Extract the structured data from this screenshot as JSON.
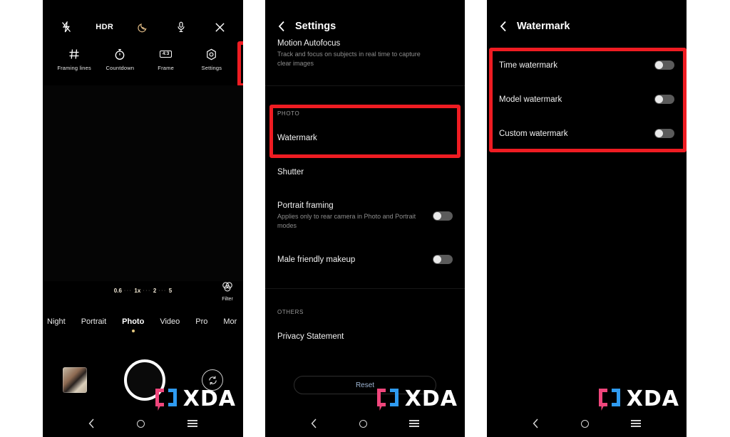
{
  "panels": {
    "camera": {
      "name": "camera-viewfinder",
      "top_icons": [
        {
          "id": "flash-off-icon",
          "label": ""
        },
        {
          "id": "hdr-icon",
          "label": "HDR"
        },
        {
          "id": "night-mode-icon",
          "label": ""
        },
        {
          "id": "microphone-icon",
          "label": ""
        },
        {
          "id": "close-icon",
          "label": ""
        }
      ],
      "tools": [
        {
          "id": "framing-lines-tool",
          "label": "Framing lines",
          "icon": "grid-icon"
        },
        {
          "id": "countdown-tool",
          "label": "Countdown",
          "icon": "timer-icon"
        },
        {
          "id": "frame-tool",
          "label": "Frame",
          "icon": "aspect-ratio-icon",
          "chip": "4:3"
        },
        {
          "id": "settings-tool",
          "label": "Settings",
          "icon": "gear-icon"
        }
      ],
      "zoom_levels": [
        "0.6",
        "1x",
        "2",
        "5"
      ],
      "zoom_active": "1x",
      "filter": {
        "label": "Filter",
        "icon": "filter-icon"
      },
      "modes": [
        "Night",
        "Portrait",
        "Photo",
        "Video",
        "Pro",
        "Mor"
      ],
      "active_mode": "Photo",
      "shutter_label": "shutter-button",
      "gallery_label": "gallery-thumbnail",
      "flip_label": "flip-camera-button"
    },
    "settings": {
      "title": "Settings",
      "back_icon": "back-chevron-icon",
      "motion_autofocus": {
        "title": "Motion Autofocus",
        "subtitle": "Track and focus on subjects in real time to capture clear images"
      },
      "photo_section": "PHOTO",
      "watermark_row": "Watermark",
      "shutter_row": "Shutter",
      "portrait_framing": {
        "title": "Portrait framing",
        "subtitle": "Applies only to rear camera in Photo and Portrait modes",
        "enabled": false
      },
      "male_makeup": {
        "title": "Male friendly makeup",
        "enabled": false
      },
      "others_section": "OTHERS",
      "privacy_row": "Privacy Statement",
      "reset_label": "Reset"
    },
    "watermark": {
      "title": "Watermark",
      "back_icon": "back-chevron-icon",
      "rows": [
        {
          "label": "Time watermark",
          "enabled": false
        },
        {
          "label": "Model watermark",
          "enabled": false
        },
        {
          "label": "Custom watermark",
          "enabled": false
        }
      ]
    }
  },
  "watermark_logo": {
    "word": "XDA",
    "bracket_left_color": "#f0467c",
    "bracket_right_color": "#2f9bf0"
  },
  "navbar": {
    "back": "nav-back-icon",
    "home": "nav-home-icon",
    "recents": "nav-recents-icon"
  },
  "highlight_color": "#ef1c22"
}
